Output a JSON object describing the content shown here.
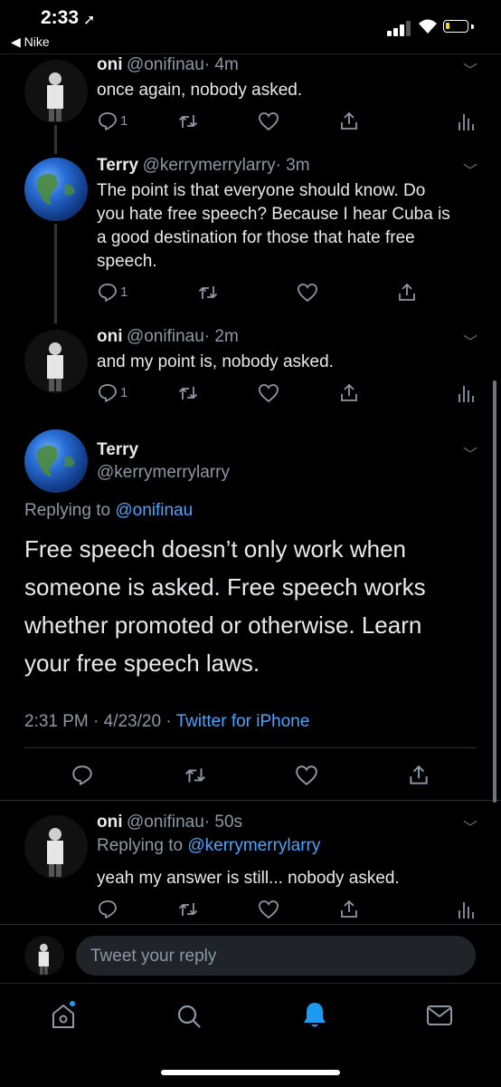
{
  "status_bar": {
    "time": "2:33",
    "back_label": "◀ Nike"
  },
  "tweets": [
    {
      "name": "oni",
      "handle": "@onifinau",
      "time": "· 4m",
      "text": "once again, nobody asked.",
      "reply_count": "1"
    },
    {
      "name": "Terry",
      "handle": "@kerrymerrylarry",
      "time": "· 3m",
      "text_lines": [
        "The point is that everyone should know. Do",
        "you hate free speech? Because I hear Cuba is",
        "a good destination for those that hate free",
        "speech."
      ],
      "reply_count": "1"
    },
    {
      "name": "oni",
      "handle": "@onifinau",
      "time": "· 2m",
      "text": "and my point is, nobody asked.",
      "reply_count": "1"
    }
  ],
  "focused_tweet": {
    "name": "Terry",
    "handle": "@kerrymerrylarry",
    "replying_prefix": "Replying to",
    "replying_to": "@onifinau",
    "text_lines": [
      "Free speech doesn’t only work when",
      "someone is asked. Free speech works",
      "whether promoted or otherwise. Learn",
      "your free speech laws."
    ],
    "timestamp": "2:31 PM · 4/23/20 ·",
    "source": "Twitter for iPhone"
  },
  "reply_tweet": {
    "name": "oni",
    "handle": "@onifinau",
    "time": "· 50s",
    "replying_prefix": "Replying to",
    "replying_to": "@kerrymerrylarry",
    "text": "yeah my answer is still... nobody asked."
  },
  "composer": {
    "placeholder": "Tweet your reply"
  },
  "tabbar": [
    "home-icon",
    "search-icon",
    "notifications-icon",
    "messages-icon"
  ],
  "colors": {
    "accent": "#1d9bf0",
    "link": "#4ea3ff",
    "muted": "#8b98a5",
    "background": "#000000"
  }
}
